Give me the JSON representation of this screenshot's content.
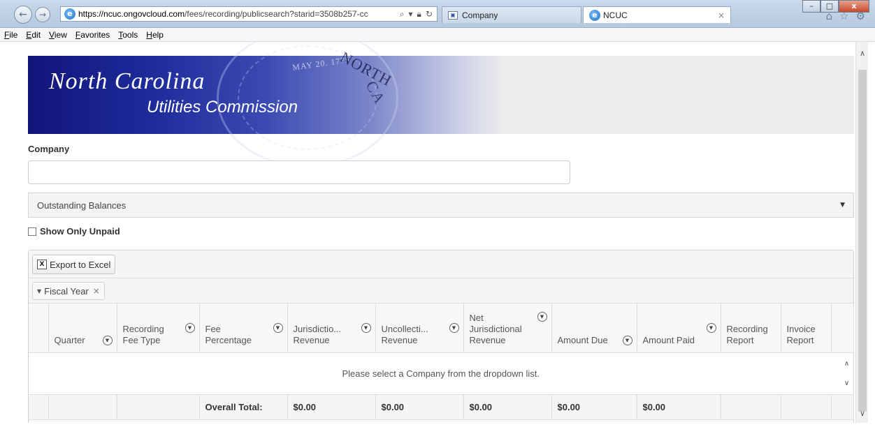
{
  "browser": {
    "url_host": "https://ncuc.ongovcloud.com",
    "url_path": "/fees/recording/publicsearch?starid=3508b257-cc",
    "tabs": [
      {
        "label": "Company",
        "active": false
      },
      {
        "label": "NCUC",
        "active": true
      }
    ],
    "window_controls": {
      "minimize": "–",
      "maximize": "□",
      "close": "x"
    },
    "menu": [
      "File",
      "Edit",
      "View",
      "Favorites",
      "Tools",
      "Help"
    ]
  },
  "banner": {
    "state": "North Carolina",
    "commission": "Utilities Commission",
    "seal_date": "MAY 20. 1775",
    "seal_text_1": "NORTH",
    "seal_text_2": "CA"
  },
  "form": {
    "company_label": "Company",
    "company_value": "",
    "report_select": "Outstanding Balances",
    "show_unpaid_label": "Show Only Unpaid",
    "show_unpaid_checked": false
  },
  "grid": {
    "export_label": "Export to Excel",
    "group_chip": "Fiscal Year",
    "columns": [
      {
        "label": "Quarter",
        "filter": true
      },
      {
        "label": "Recording Fee Type",
        "filter": true
      },
      {
        "label": "Fee Percentage",
        "filter": true
      },
      {
        "label": "Jurisdictio... Revenue",
        "filter": true
      },
      {
        "label": "Uncollecti... Revenue",
        "filter": true
      },
      {
        "label": "Net Jurisdictional Revenue",
        "filter": true
      },
      {
        "label": "Amount Due",
        "filter": true
      },
      {
        "label": "Amount Paid",
        "filter": true
      },
      {
        "label": "Recording Report",
        "filter": false
      },
      {
        "label": "Invoice Report",
        "filter": false
      }
    ],
    "empty_message": "Please select a Company from the dropdown list.",
    "footer": {
      "label": "Overall Total:",
      "jurisdictional_revenue": "$0.00",
      "uncollectible_revenue": "$0.00",
      "net_jurisdictional_revenue": "$0.00",
      "amount_due": "$0.00",
      "amount_paid": "$0.00"
    }
  }
}
